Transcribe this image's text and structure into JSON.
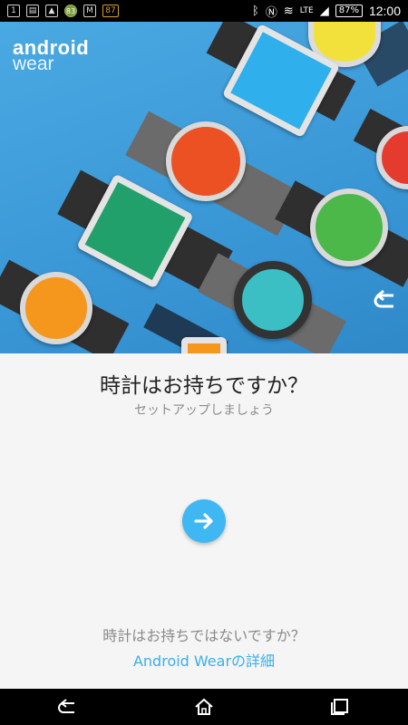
{
  "status_bar": {
    "left_icons": [
      "sim-1-icon",
      "sim-card-icon",
      "picture-icon",
      "android-icon",
      "gmail-icon",
      "battery-alert-icon"
    ],
    "notif_badge": "83",
    "notif_badge2": "87",
    "network": "LTE",
    "battery": "87%",
    "time": "12:00"
  },
  "hero": {
    "brand_line1": "android",
    "brand_line2": "wear"
  },
  "main": {
    "title": "時計はお持ちですか？",
    "subtitle": "セットアップしましょう",
    "no_watch_text": "時計はお持ちではないですか？",
    "learn_more_link": "Android Wearの詳細"
  },
  "colors": {
    "accent": "#3fb7f2",
    "hero_bg": "#3a97d6",
    "link": "#3ab0e8"
  },
  "nav": {
    "icons": [
      "back-icon",
      "home-icon",
      "recents-icon"
    ]
  }
}
